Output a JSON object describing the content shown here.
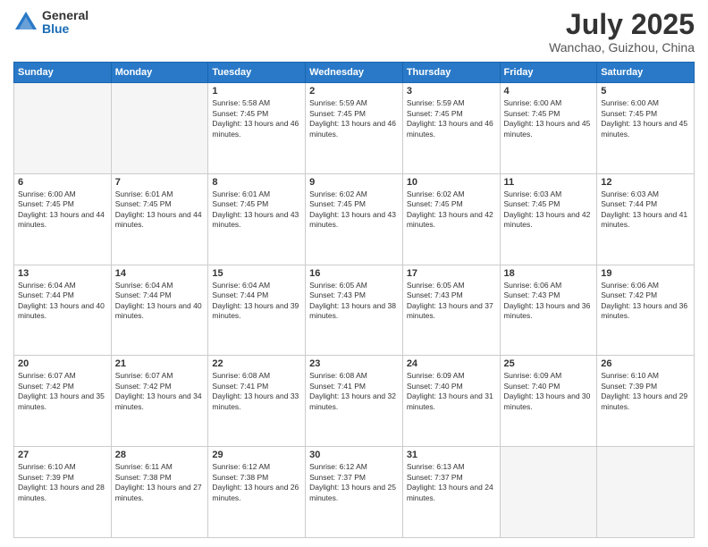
{
  "header": {
    "logo_general": "General",
    "logo_blue": "Blue",
    "month_year": "July 2025",
    "location": "Wanchao, Guizhou, China"
  },
  "days_of_week": [
    "Sunday",
    "Monday",
    "Tuesday",
    "Wednesday",
    "Thursday",
    "Friday",
    "Saturday"
  ],
  "weeks": [
    [
      {
        "day": "",
        "sunrise": "",
        "sunset": "",
        "daylight": ""
      },
      {
        "day": "",
        "sunrise": "",
        "sunset": "",
        "daylight": ""
      },
      {
        "day": "1",
        "sunrise": "Sunrise: 5:58 AM",
        "sunset": "Sunset: 7:45 PM",
        "daylight": "Daylight: 13 hours and 46 minutes."
      },
      {
        "day": "2",
        "sunrise": "Sunrise: 5:59 AM",
        "sunset": "Sunset: 7:45 PM",
        "daylight": "Daylight: 13 hours and 46 minutes."
      },
      {
        "day": "3",
        "sunrise": "Sunrise: 5:59 AM",
        "sunset": "Sunset: 7:45 PM",
        "daylight": "Daylight: 13 hours and 46 minutes."
      },
      {
        "day": "4",
        "sunrise": "Sunrise: 6:00 AM",
        "sunset": "Sunset: 7:45 PM",
        "daylight": "Daylight: 13 hours and 45 minutes."
      },
      {
        "day": "5",
        "sunrise": "Sunrise: 6:00 AM",
        "sunset": "Sunset: 7:45 PM",
        "daylight": "Daylight: 13 hours and 45 minutes."
      }
    ],
    [
      {
        "day": "6",
        "sunrise": "Sunrise: 6:00 AM",
        "sunset": "Sunset: 7:45 PM",
        "daylight": "Daylight: 13 hours and 44 minutes."
      },
      {
        "day": "7",
        "sunrise": "Sunrise: 6:01 AM",
        "sunset": "Sunset: 7:45 PM",
        "daylight": "Daylight: 13 hours and 44 minutes."
      },
      {
        "day": "8",
        "sunrise": "Sunrise: 6:01 AM",
        "sunset": "Sunset: 7:45 PM",
        "daylight": "Daylight: 13 hours and 43 minutes."
      },
      {
        "day": "9",
        "sunrise": "Sunrise: 6:02 AM",
        "sunset": "Sunset: 7:45 PM",
        "daylight": "Daylight: 13 hours and 43 minutes."
      },
      {
        "day": "10",
        "sunrise": "Sunrise: 6:02 AM",
        "sunset": "Sunset: 7:45 PM",
        "daylight": "Daylight: 13 hours and 42 minutes."
      },
      {
        "day": "11",
        "sunrise": "Sunrise: 6:03 AM",
        "sunset": "Sunset: 7:45 PM",
        "daylight": "Daylight: 13 hours and 42 minutes."
      },
      {
        "day": "12",
        "sunrise": "Sunrise: 6:03 AM",
        "sunset": "Sunset: 7:44 PM",
        "daylight": "Daylight: 13 hours and 41 minutes."
      }
    ],
    [
      {
        "day": "13",
        "sunrise": "Sunrise: 6:04 AM",
        "sunset": "Sunset: 7:44 PM",
        "daylight": "Daylight: 13 hours and 40 minutes."
      },
      {
        "day": "14",
        "sunrise": "Sunrise: 6:04 AM",
        "sunset": "Sunset: 7:44 PM",
        "daylight": "Daylight: 13 hours and 40 minutes."
      },
      {
        "day": "15",
        "sunrise": "Sunrise: 6:04 AM",
        "sunset": "Sunset: 7:44 PM",
        "daylight": "Daylight: 13 hours and 39 minutes."
      },
      {
        "day": "16",
        "sunrise": "Sunrise: 6:05 AM",
        "sunset": "Sunset: 7:43 PM",
        "daylight": "Daylight: 13 hours and 38 minutes."
      },
      {
        "day": "17",
        "sunrise": "Sunrise: 6:05 AM",
        "sunset": "Sunset: 7:43 PM",
        "daylight": "Daylight: 13 hours and 37 minutes."
      },
      {
        "day": "18",
        "sunrise": "Sunrise: 6:06 AM",
        "sunset": "Sunset: 7:43 PM",
        "daylight": "Daylight: 13 hours and 36 minutes."
      },
      {
        "day": "19",
        "sunrise": "Sunrise: 6:06 AM",
        "sunset": "Sunset: 7:42 PM",
        "daylight": "Daylight: 13 hours and 36 minutes."
      }
    ],
    [
      {
        "day": "20",
        "sunrise": "Sunrise: 6:07 AM",
        "sunset": "Sunset: 7:42 PM",
        "daylight": "Daylight: 13 hours and 35 minutes."
      },
      {
        "day": "21",
        "sunrise": "Sunrise: 6:07 AM",
        "sunset": "Sunset: 7:42 PM",
        "daylight": "Daylight: 13 hours and 34 minutes."
      },
      {
        "day": "22",
        "sunrise": "Sunrise: 6:08 AM",
        "sunset": "Sunset: 7:41 PM",
        "daylight": "Daylight: 13 hours and 33 minutes."
      },
      {
        "day": "23",
        "sunrise": "Sunrise: 6:08 AM",
        "sunset": "Sunset: 7:41 PM",
        "daylight": "Daylight: 13 hours and 32 minutes."
      },
      {
        "day": "24",
        "sunrise": "Sunrise: 6:09 AM",
        "sunset": "Sunset: 7:40 PM",
        "daylight": "Daylight: 13 hours and 31 minutes."
      },
      {
        "day": "25",
        "sunrise": "Sunrise: 6:09 AM",
        "sunset": "Sunset: 7:40 PM",
        "daylight": "Daylight: 13 hours and 30 minutes."
      },
      {
        "day": "26",
        "sunrise": "Sunrise: 6:10 AM",
        "sunset": "Sunset: 7:39 PM",
        "daylight": "Daylight: 13 hours and 29 minutes."
      }
    ],
    [
      {
        "day": "27",
        "sunrise": "Sunrise: 6:10 AM",
        "sunset": "Sunset: 7:39 PM",
        "daylight": "Daylight: 13 hours and 28 minutes."
      },
      {
        "day": "28",
        "sunrise": "Sunrise: 6:11 AM",
        "sunset": "Sunset: 7:38 PM",
        "daylight": "Daylight: 13 hours and 27 minutes."
      },
      {
        "day": "29",
        "sunrise": "Sunrise: 6:12 AM",
        "sunset": "Sunset: 7:38 PM",
        "daylight": "Daylight: 13 hours and 26 minutes."
      },
      {
        "day": "30",
        "sunrise": "Sunrise: 6:12 AM",
        "sunset": "Sunset: 7:37 PM",
        "daylight": "Daylight: 13 hours and 25 minutes."
      },
      {
        "day": "31",
        "sunrise": "Sunrise: 6:13 AM",
        "sunset": "Sunset: 7:37 PM",
        "daylight": "Daylight: 13 hours and 24 minutes."
      },
      {
        "day": "",
        "sunrise": "",
        "sunset": "",
        "daylight": ""
      },
      {
        "day": "",
        "sunrise": "",
        "sunset": "",
        "daylight": ""
      }
    ]
  ]
}
